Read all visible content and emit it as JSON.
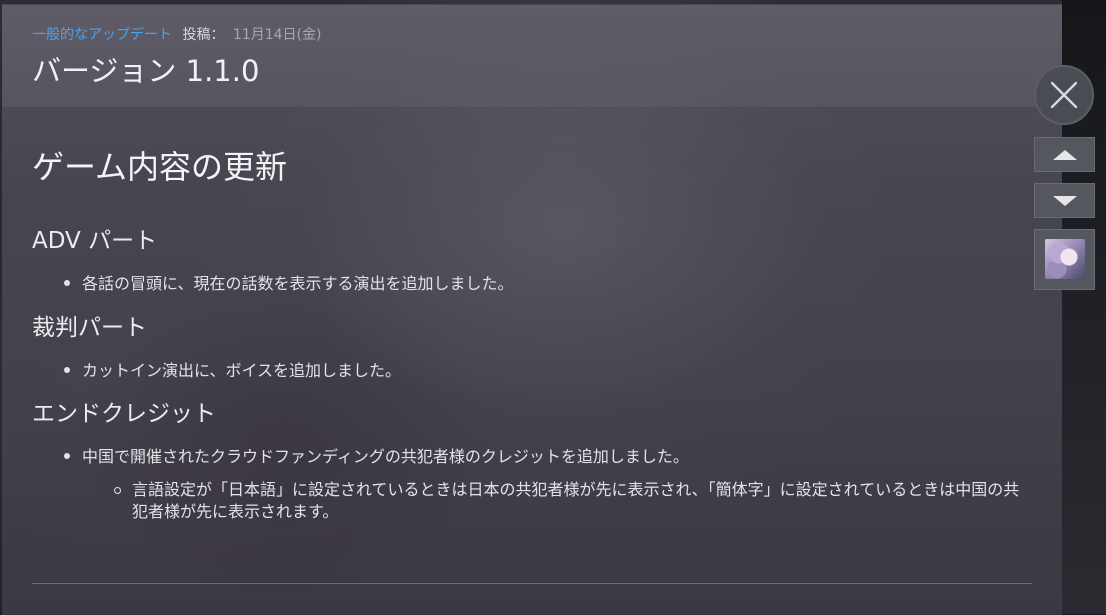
{
  "post": {
    "category": "一般的なアップデート",
    "posted_label": "投稿：",
    "date": "11月14日(金)",
    "title": "バージョン 1.1.0"
  },
  "body": {
    "heading": "ゲーム内容の更新",
    "sections": [
      {
        "title": "ADV パート",
        "bullets": [
          "各話の冒頭に、現在の話数を表示する演出を追加しました。"
        ]
      },
      {
        "title": "裁判パート",
        "bullets": [
          "カットイン演出に、ボイスを追加しました。"
        ]
      },
      {
        "title": "エンドクレジット",
        "bullets": [
          "中国で開催されたクラウドファンディングの共犯者様のクレジットを追加しました。"
        ],
        "sub_bullets": [
          "言語設定が「日本語」に設定されているときは日本の共犯者様が先に表示され、「簡体字」に設定されているときは中国の共犯者様が先に表示されます。"
        ]
      }
    ]
  },
  "controls": {
    "close_icon": "close-icon",
    "prev_icon": "triangle-up-icon",
    "next_icon": "triangle-down-icon",
    "thumbnail": "game-thumbnail"
  },
  "colors": {
    "category_link": "#4aa4ea",
    "text_primary": "#f2f2f4",
    "text_secondary": "#a7a8ae"
  }
}
